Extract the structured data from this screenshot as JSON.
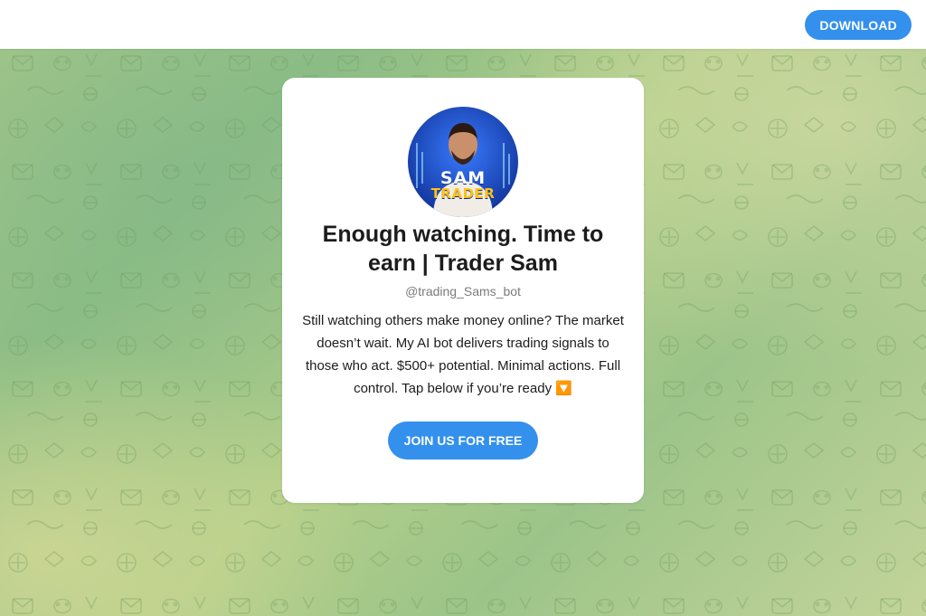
{
  "header": {
    "download_label": "DOWNLOAD"
  },
  "profile": {
    "avatar_text_top": "SAM",
    "avatar_text_bottom": "TRADER",
    "title": "Enough watching. Time to earn | Trader Sam",
    "handle": "@trading_Sams_bot",
    "description": "Still watching others make money online? The market doesn’t wait. My AI bot delivers trading signals to those who act. $500+ potential. Minimal actions. Full control. Tap below if you’re ready 🔽",
    "join_label": "JOIN US FOR FREE"
  },
  "colors": {
    "accent": "#3390ec",
    "background_green": "#a8c98a",
    "avatar_blue": "#1b4fd1",
    "avatar_yellow": "#ffc21a"
  }
}
